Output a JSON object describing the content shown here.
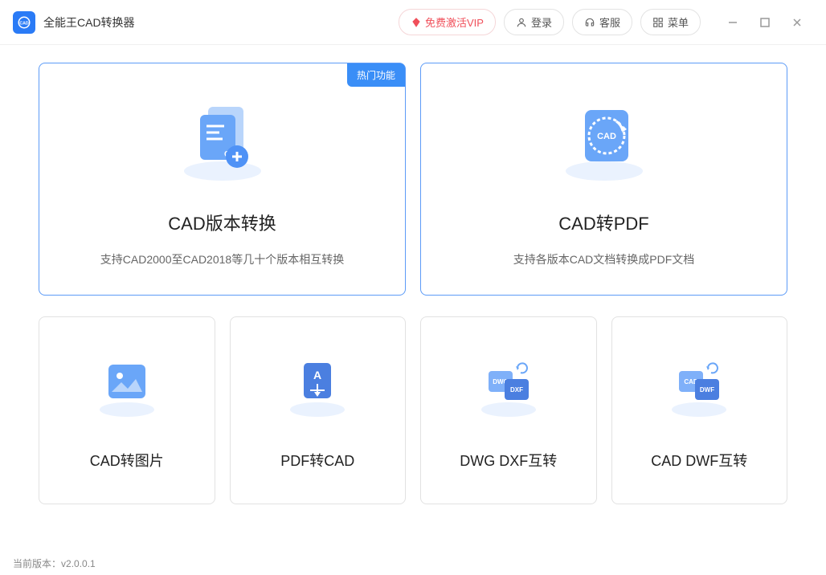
{
  "app": {
    "title": "全能王CAD转换器"
  },
  "header": {
    "vip": "免费激活VIP",
    "login": "登录",
    "support": "客服",
    "menu": "菜单"
  },
  "cards": {
    "badge": "热门功能",
    "version_convert": {
      "title": "CAD版本转换",
      "desc": "支持CAD2000至CAD2018等几十个版本相互转换"
    },
    "to_pdf": {
      "title": "CAD转PDF",
      "desc": "支持各版本CAD文档转换成PDF文档"
    },
    "to_image": {
      "title": "CAD转图片"
    },
    "pdf_to_cad": {
      "title": "PDF转CAD"
    },
    "dwg_dxf": {
      "title": "DWG DXF互转"
    },
    "cad_dwf": {
      "title": "CAD DWF互转"
    }
  },
  "status": {
    "version_label": "当前版本：",
    "version": "v2.0.0.1"
  }
}
